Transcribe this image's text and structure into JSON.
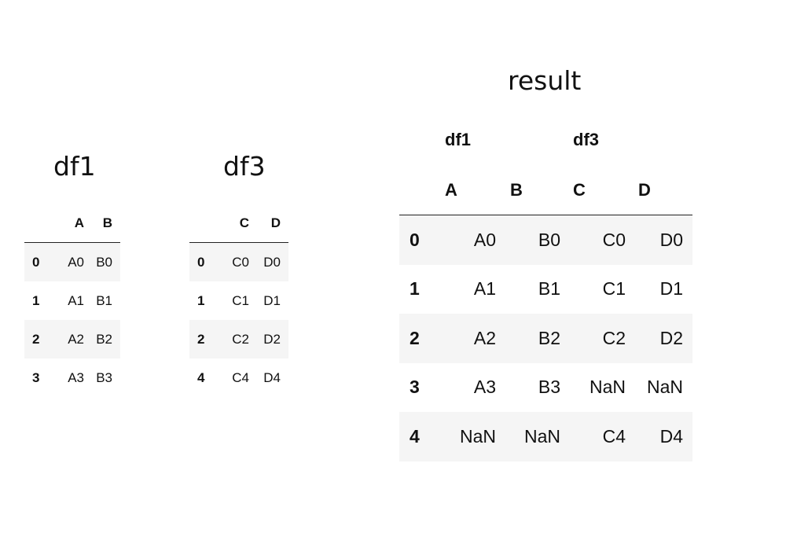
{
  "tables": {
    "df1": {
      "title": "df1",
      "columns": [
        "A",
        "B"
      ],
      "rows": [
        {
          "index": "0",
          "values": [
            "A0",
            "B0"
          ]
        },
        {
          "index": "1",
          "values": [
            "A1",
            "B1"
          ]
        },
        {
          "index": "2",
          "values": [
            "A2",
            "B2"
          ]
        },
        {
          "index": "3",
          "values": [
            "A3",
            "B3"
          ]
        }
      ]
    },
    "df3": {
      "title": "df3",
      "columns": [
        "C",
        "D"
      ],
      "rows": [
        {
          "index": "0",
          "values": [
            "C0",
            "D0"
          ]
        },
        {
          "index": "1",
          "values": [
            "C1",
            "D1"
          ]
        },
        {
          "index": "2",
          "values": [
            "C2",
            "D2"
          ]
        },
        {
          "index": "4",
          "values": [
            "C4",
            "D4"
          ]
        }
      ]
    },
    "result": {
      "title": "result",
      "groups": [
        "df1",
        "df3"
      ],
      "columns": [
        "A",
        "B",
        "C",
        "D"
      ],
      "rows": [
        {
          "index": "0",
          "values": [
            "A0",
            "B0",
            "C0",
            "D0"
          ]
        },
        {
          "index": "1",
          "values": [
            "A1",
            "B1",
            "C1",
            "D1"
          ]
        },
        {
          "index": "2",
          "values": [
            "A2",
            "B2",
            "C2",
            "D2"
          ]
        },
        {
          "index": "3",
          "values": [
            "A3",
            "B3",
            "NaN",
            "NaN"
          ]
        },
        {
          "index": "4",
          "values": [
            "NaN",
            "NaN",
            "C4",
            "D4"
          ]
        }
      ]
    }
  }
}
